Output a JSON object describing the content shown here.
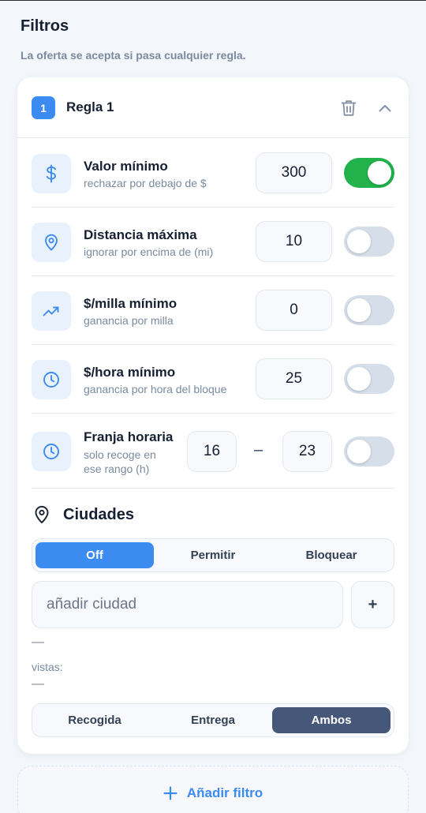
{
  "page": {
    "title": "Filtros",
    "subtitle": "La oferta se acepta si pasa cualquier regla."
  },
  "rule": {
    "number": "1",
    "title": "Regla 1",
    "icons": {
      "delete": "trash-icon",
      "collapse": "chevron-up-icon"
    }
  },
  "filters": {
    "min_value": {
      "icon": "dollar-icon",
      "label": "Valor mínimo",
      "sub": "rechazar por debajo de $",
      "value": "300",
      "enabled": true
    },
    "max_distance": {
      "icon": "map-pin-icon",
      "label": "Distancia máxima",
      "sub": "ignorar por encima de (mi)",
      "value": "10",
      "enabled": false
    },
    "min_per_mile": {
      "icon": "trending-up-icon",
      "label": "$/milla mínimo",
      "sub": "ganancia por milla",
      "value": "0",
      "enabled": false
    },
    "min_per_hour": {
      "icon": "clock-icon",
      "label": "$/hora mínimo",
      "sub": "ganancia por hora del bloque",
      "value": "25",
      "enabled": false
    },
    "time_window": {
      "icon": "clock-icon",
      "label": "Franja horaria",
      "sub_line1": "solo recoge en",
      "sub_line2": "ese rango (h)",
      "from": "16",
      "separator": "–",
      "to": "23",
      "enabled": false
    }
  },
  "cities": {
    "icon": "map-pin-icon",
    "title": "Ciudades",
    "mode_options": [
      "Off",
      "Permitir",
      "Bloquear"
    ],
    "mode_selected": "Off",
    "input_placeholder": "añadir ciudad",
    "add_label": "+",
    "list_placeholder": "—",
    "seen_label": "vistas:",
    "seen_placeholder": "—",
    "scope_options": [
      "Recogida",
      "Entrega",
      "Ambos"
    ],
    "scope_selected": "Ambos"
  },
  "add_filter": {
    "icon": "plus-icon",
    "label": "Añadir filtro"
  },
  "colors": {
    "accent": "#3b8bf0",
    "toggle_on": "#22b24c",
    "toggle_off": "#d6dee9",
    "selected_dark": "#46587a"
  }
}
